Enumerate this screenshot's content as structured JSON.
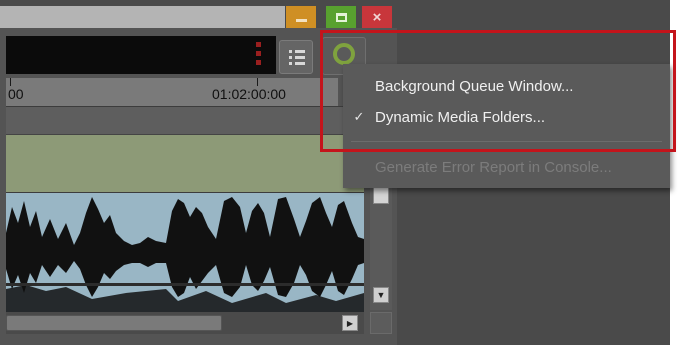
{
  "window": {
    "controls": [
      {
        "icon": "minimize-icon"
      },
      {
        "icon": "maximize-icon"
      },
      {
        "icon": "close-icon",
        "label": "×"
      }
    ]
  },
  "toolbar": {
    "list_button_icon": "list-view-icon",
    "activity_button_icon": "activity-ring-icon"
  },
  "timeline": {
    "ruler_labels": [
      "00",
      "01:02:00:00"
    ]
  },
  "scrollbars": {
    "down_arrow": "▼",
    "right_arrow": "▶"
  },
  "menu": {
    "items": [
      {
        "label": "Background Queue Window...",
        "checked": false,
        "enabled": true
      },
      {
        "label": "Dynamic Media Folders...",
        "checked": true,
        "enabled": true,
        "check_mark": "✓"
      },
      {
        "label": "Generate Error Report in Console...",
        "checked": false,
        "enabled": false
      }
    ]
  },
  "colors": {
    "highlight": "#c4141b",
    "activity_ring": "#7fa23e",
    "video_track": "#8d9a77",
    "audio_track": "#99b6c5"
  }
}
